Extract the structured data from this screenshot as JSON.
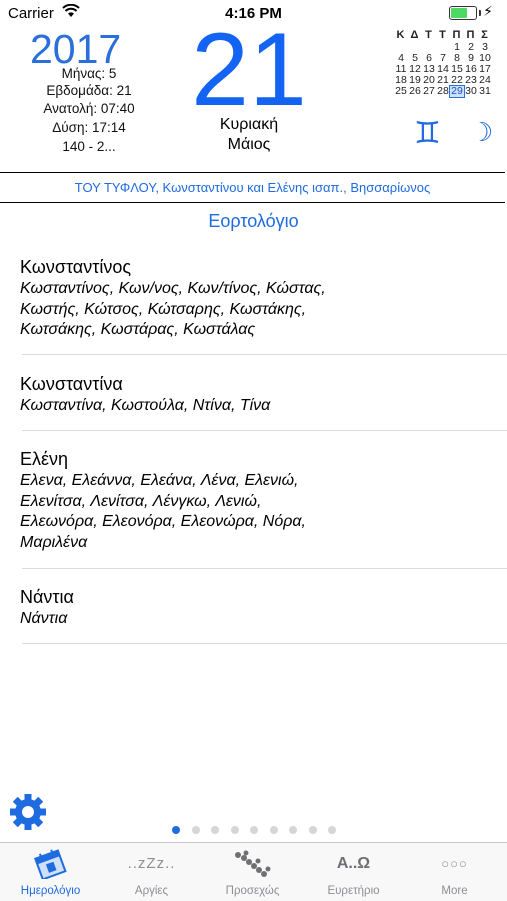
{
  "status_bar": {
    "carrier": "Carrier",
    "time": "4:16 PM",
    "battery_level": 0.62,
    "battery_color": "#4cd964"
  },
  "header": {
    "year": "2017",
    "month_label": "Μήνας: 5",
    "week_label": "Εβδομάδα: 21",
    "sunrise_label": "Ανατολή: 07:40",
    "sunset_label": "Δύση: 17:14",
    "day_count": "140 - 2...",
    "day_number": "21",
    "weekday": "Κυριακή",
    "month_name": "Μάιος",
    "zodiac_icon": "gemini-icon",
    "zodiac_symbol": "♊",
    "moon_icon": "crescent-moon-icon",
    "moon_symbol": "☽"
  },
  "mini_calendar": {
    "weekday_headers": [
      "Κ",
      "Δ",
      "Τ",
      "Τ",
      "Π",
      "Π",
      "Σ"
    ],
    "weeks": [
      [
        "",
        "",
        "1",
        "2",
        "3",
        "4",
        "5"
      ],
      [
        "6",
        "7",
        "8",
        "9",
        "10",
        "11",
        "12"
      ],
      [
        "13",
        "14",
        "15",
        "16",
        "17",
        "18",
        "19"
      ],
      [
        "20",
        "21",
        "22",
        "23",
        "24",
        "25",
        "26"
      ],
      [
        "27",
        "28",
        "29",
        "30",
        "31",
        "",
        ""
      ]
    ],
    "calendar_rows_as_shown": [
      [
        "",
        "",
        "",
        "",
        "",
        "1",
        "2",
        "3"
      ],
      [
        "4",
        "5",
        "6",
        "7",
        "8",
        "9",
        "10"
      ],
      [
        "11",
        "12",
        "13",
        "14",
        "15",
        "16",
        "17"
      ],
      [
        "18",
        "19",
        "20",
        "21",
        "22",
        "23",
        "24"
      ],
      [
        "25",
        "26",
        "27",
        "28",
        "29",
        "30",
        "31"
      ]
    ],
    "highlighted_day": "29"
  },
  "feast_line": "ΤΟΥ ΤΥΦΛΟΥ, Κωνσταντίνου και Ελένης ισαπ., Βησσαρίωνος",
  "section_title": "Εορτολόγιο",
  "entries": [
    {
      "name": "Κωνσταντίνος",
      "lines": [
        "Κωσταντίνος, Κων/νος, Κων/τίνος, Κώστας,",
        "Κωστής, Κώτσος, Κώτσαρης, Κωστάκης,",
        "Κωτσάκης, Κωστάρας, Κωστάλας"
      ]
    },
    {
      "name": "Κωνσταντίνα",
      "lines": [
        "Κωσταντίνα, Κωστούλα, Ντίνα, Τίνα"
      ]
    },
    {
      "name": "Ελένη",
      "lines": [
        "Ελενα, Ελεάννα, Ελεάνα, Λένα, Ελενιώ,",
        "Ελενίτσα, Λενίτσα, Λένγκω, Λενιώ,",
        "Ελεωνόρα, Ελεονόρα, Ελεονώρα, Νόρα,",
        "Μαριλένα"
      ]
    },
    {
      "name": "Νάντια",
      "lines": [
        "Νάντια"
      ]
    }
  ],
  "page_dots": {
    "count": 9,
    "active_index": 0
  },
  "settings_icon": "gear-icon",
  "tabs": [
    {
      "label": "Ημερολόγιο",
      "icon": "calendar-icon",
      "selected": true
    },
    {
      "label": "Αργίες",
      "icon": "sleep-icon",
      "glyph": "..zZz..",
      "selected": false
    },
    {
      "label": "Προσεχώς",
      "icon": "dots-diagonal-icon",
      "selected": false
    },
    {
      "label": "Ευρετήριο",
      "icon": "alpha-omega-icon",
      "glyph": "A..Ω",
      "selected": false
    },
    {
      "label": "More",
      "icon": "more-icon",
      "glyph": "○○○",
      "selected": false
    }
  ],
  "colors": {
    "accent": "#1f6be0",
    "tab_inactive": "#8e8e93"
  }
}
